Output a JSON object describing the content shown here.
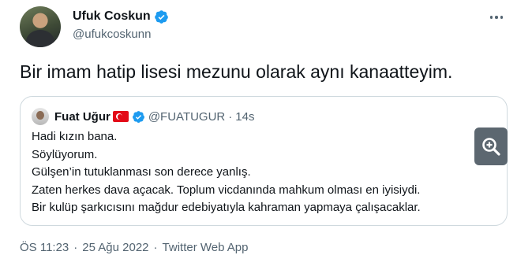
{
  "author": {
    "display_name": "Ufuk Coskun",
    "handle": "@ufukcoskunn"
  },
  "tweet": {
    "text": "Bir imam hatip lisesi mezunu olarak aynı kanaatteyim."
  },
  "quoted_tweet": {
    "display_name": "Fuat Uğur",
    "handle": "@FUATUGUR",
    "separator": "·",
    "time": "14s",
    "lines": [
      "Hadi kızın bana.",
      "Söylüyorum.",
      "Gülşen’in tutuklanması son derece yanlış.",
      "Zaten herkes dava açacak. Toplum vicdanında mahkum olması en iyisiydi.",
      "Bir kulüp şarkıcısını mağdur edebiyatıyla kahraman yapmaya çalışacaklar."
    ]
  },
  "meta": {
    "time": "ÖS 11:23",
    "separator": "·",
    "date": "25 Ağu 2022",
    "app": "Twitter Web App"
  },
  "colors": {
    "verified": "#1d9bf0",
    "secondary_text": "#536471",
    "border": "#cfd9de",
    "flag": "#e30a17"
  },
  "icons": {
    "verified": "verified-badge-icon",
    "more": "more-options-icon",
    "zoom": "zoom-in-icon",
    "flag": "turkey-flag-icon"
  }
}
